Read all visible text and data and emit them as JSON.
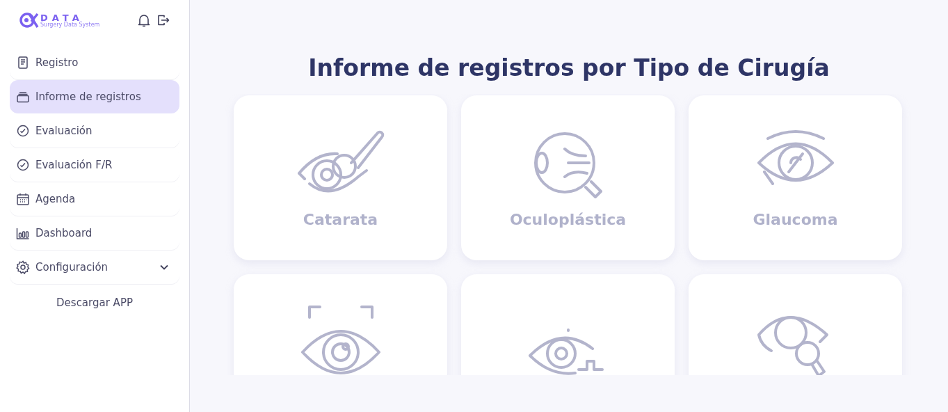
{
  "brand": {
    "name": "DATA",
    "tagline": "Surgery Data System"
  },
  "nav": [
    {
      "label": "Registro",
      "kind": "document",
      "selected": false
    },
    {
      "label": "Informe de registros",
      "kind": "stack",
      "selected": true
    },
    {
      "label": "Evaluación",
      "kind": "check",
      "selected": false
    },
    {
      "label": "Evaluación F/R",
      "kind": "check",
      "selected": false
    },
    {
      "label": "Agenda",
      "kind": "calendar",
      "selected": false
    },
    {
      "label": "Dashboard",
      "kind": "bars",
      "selected": false
    },
    {
      "label": "Configuración",
      "kind": "gear",
      "selected": false,
      "expanded": false
    }
  ],
  "download_link": "Descargar APP",
  "page_title": "Informe de registros por Tipo de Cirugía",
  "cards": [
    {
      "label": "Catarata",
      "kind": "scalpel"
    },
    {
      "label": "Oculoplástica",
      "kind": "eyeball"
    },
    {
      "label": "Glaucoma",
      "kind": "slash"
    },
    {
      "kind": "scan"
    },
    {
      "kind": "plus"
    },
    {
      "kind": "magnifier"
    }
  ]
}
